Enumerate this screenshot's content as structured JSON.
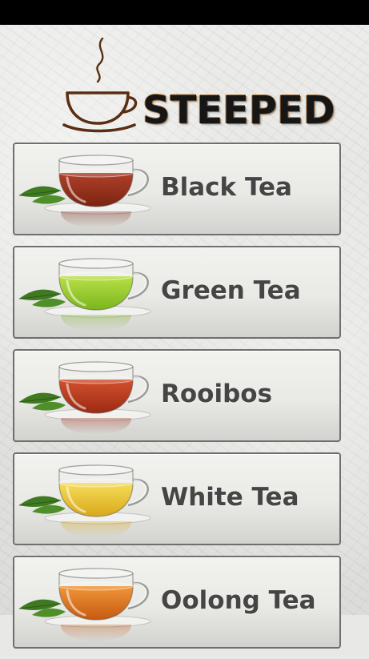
{
  "app": {
    "title": "STEEPED",
    "logo_icon": "steaming-teacup-icon"
  },
  "teas": [
    {
      "label": "Black Tea",
      "icon": "teacup-icon",
      "liquid_color": "#7a2410",
      "liquid_light": "#b0402a"
    },
    {
      "label": "Green Tea",
      "icon": "teacup-icon",
      "liquid_color": "#7bb51d",
      "liquid_light": "#b9e046"
    },
    {
      "label": "Rooibos",
      "icon": "teacup-icon",
      "liquid_color": "#9c2a12",
      "liquid_light": "#d2502e"
    },
    {
      "label": "White Tea",
      "icon": "teacup-icon",
      "liquid_color": "#d9a81a",
      "liquid_light": "#f6dd5a"
    },
    {
      "label": "Oolong Tea",
      "icon": "teacup-icon",
      "liquid_color": "#c65a10",
      "liquid_light": "#f0963a"
    }
  ]
}
